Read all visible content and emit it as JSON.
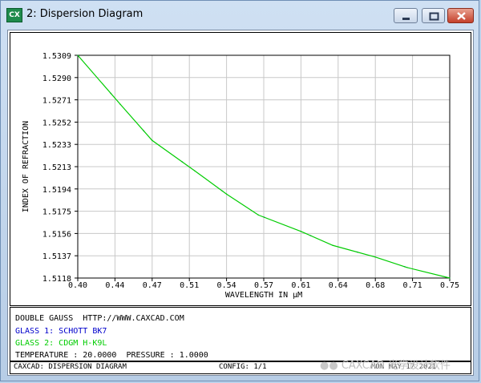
{
  "window": {
    "icon_text": "CX",
    "title": "2: Dispersion Diagram",
    "buttons": [
      "minimize",
      "maximize",
      "close"
    ]
  },
  "chart_data": {
    "type": "line",
    "title": "",
    "xlabel": "WAVELENGTH IN µM",
    "ylabel": "INDEX OF REFRACTION",
    "xlim": [
      0.4,
      0.75
    ],
    "ylim": [
      1.5118,
      1.5309
    ],
    "xticks": [
      "0.40",
      "0.44",
      "0.47",
      "0.51",
      "0.54",
      "0.57",
      "0.61",
      "0.64",
      "0.68",
      "0.71",
      "0.75"
    ],
    "yticks": [
      "1.5309",
      "1.5290",
      "1.5271",
      "1.5252",
      "1.5233",
      "1.5213",
      "1.5194",
      "1.5175",
      "1.5156",
      "1.5137",
      "1.5118"
    ],
    "grid": true,
    "series": [
      {
        "name": "SCHOTT BK7",
        "color": "#0000cc",
        "x": [
          0.4,
          0.44,
          0.47,
          0.51,
          0.54,
          0.57,
          0.61,
          0.64,
          0.68,
          0.71,
          0.75
        ],
        "y": [
          1.5309,
          1.5267,
          1.5236,
          1.521,
          1.519,
          1.5172,
          1.5158,
          1.5146,
          1.5136,
          1.5127,
          1.5118
        ]
      },
      {
        "name": "CDGM H-K9L",
        "color": "#00cc00",
        "x": [
          0.4,
          0.44,
          0.47,
          0.51,
          0.54,
          0.57,
          0.61,
          0.64,
          0.68,
          0.71,
          0.75
        ],
        "y": [
          1.5309,
          1.5267,
          1.5236,
          1.521,
          1.519,
          1.5172,
          1.5158,
          1.5146,
          1.5136,
          1.5127,
          1.5118
        ]
      }
    ]
  },
  "info": {
    "line1": "DOUBLE GAUSS  HTTP://WWW.CAXCAD.COM",
    "glass1": "GLASS 1: SCHOTT BK7",
    "glass2": "GLASS 2: CDGM H-K9L",
    "conditions": "TEMPERATURE : 20.0000  PRESSURE : 1.0000",
    "glass1_color": "#0000cc",
    "glass2_color": "#00cc00"
  },
  "status": {
    "left": "CAXCAD: DISPERSION DIAGRAM",
    "config": "CONFIG: 1/1",
    "date": "MON MAY 17 2021"
  },
  "watermark": "CAXCAD 光学设计软件"
}
